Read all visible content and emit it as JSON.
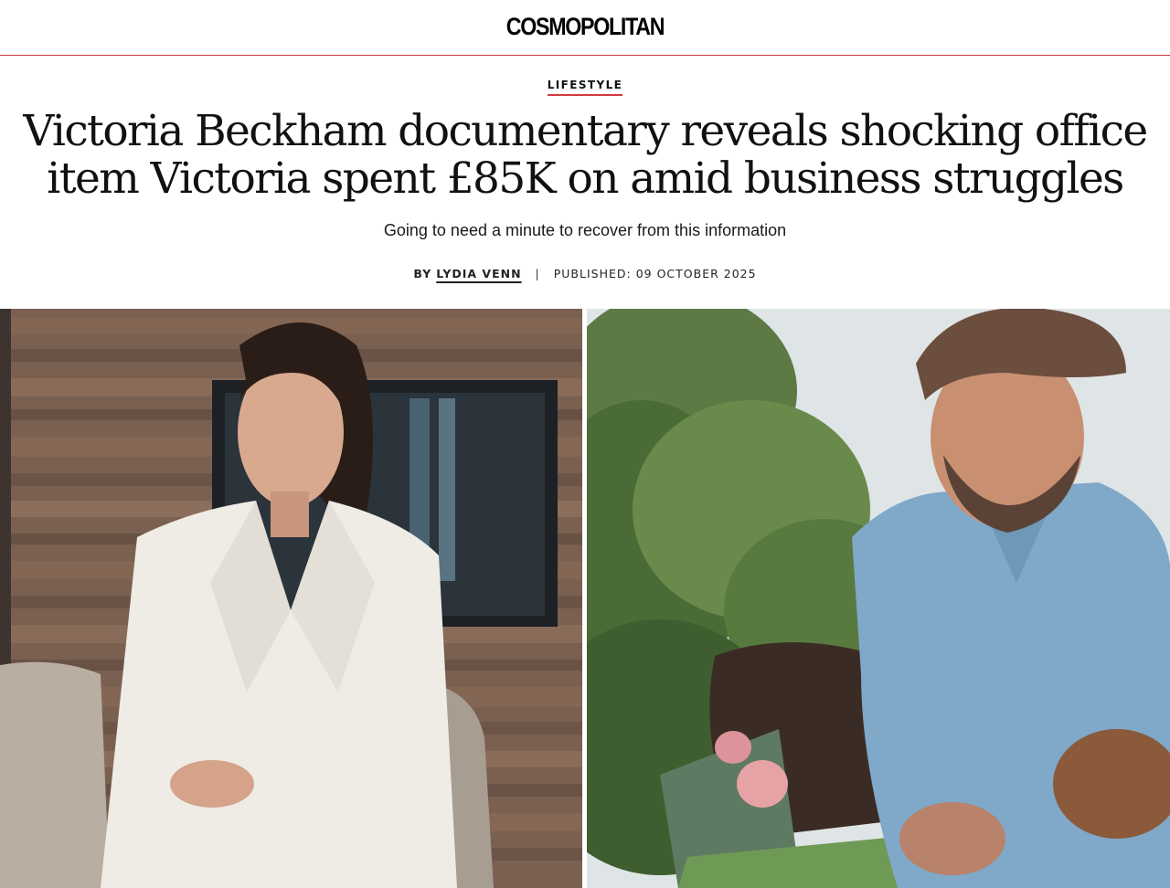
{
  "header": {
    "logo_text": "COSMOPOLITAN"
  },
  "article": {
    "section": "LIFESTYLE",
    "headline": "Victoria Beckham documentary reveals shocking office item Victoria spent £85K on amid business struggles",
    "subtitle": "Going to need a minute to recover from this information",
    "byline": {
      "by_label": "BY",
      "author": "LYDIA VENN",
      "separator": "|",
      "published_label": "PUBLISHED:",
      "published_date": "09 OCTOBER 2025"
    }
  },
  "images": {
    "left_semantic": "woman-in-white-suit-photo",
    "right_semantic": "man-in-cap-gardening-photo"
  },
  "colors": {
    "accent_red": "#c8383b",
    "text": "#111111"
  }
}
